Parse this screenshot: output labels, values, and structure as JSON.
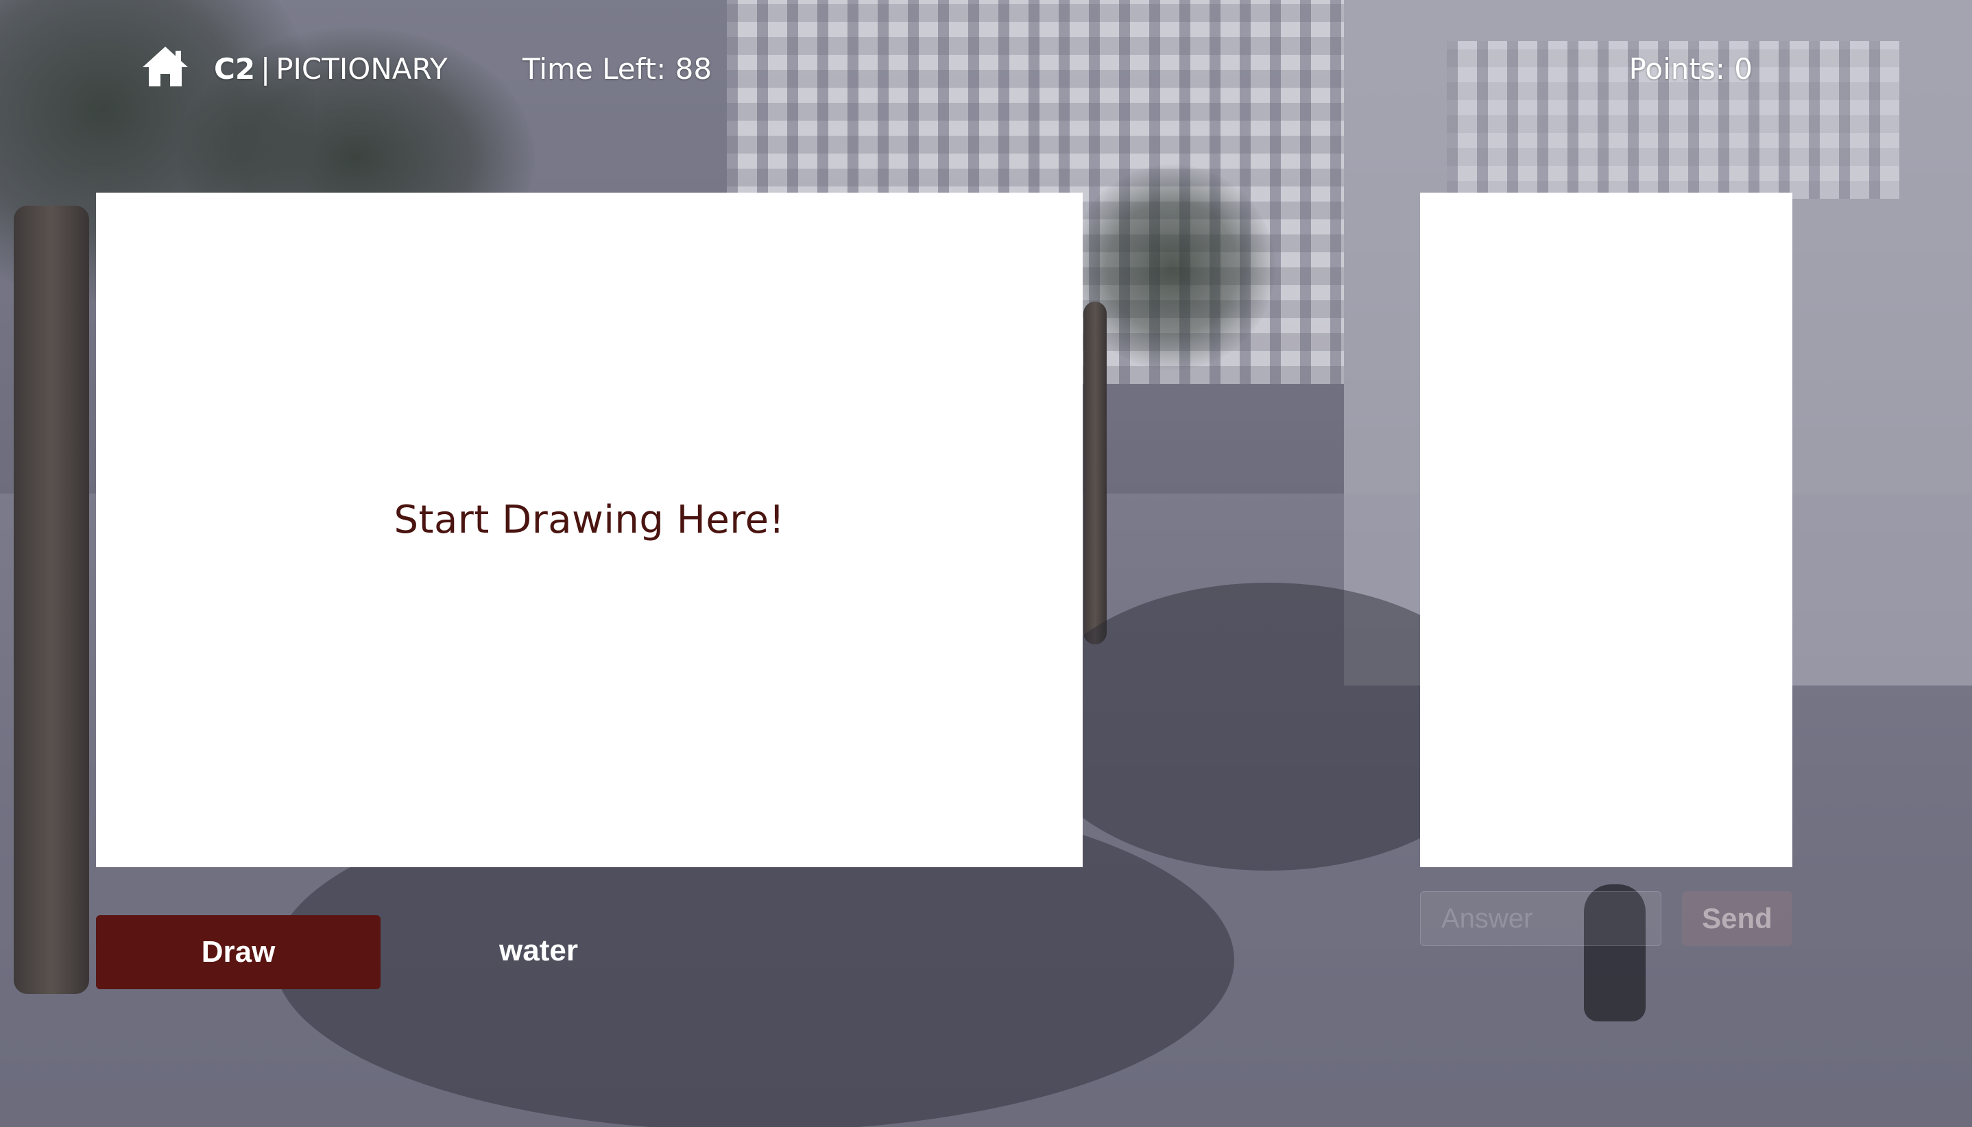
{
  "header": {
    "home_icon": "home-icon",
    "brand_code": "C2",
    "brand_separator": "|",
    "brand_name": "PICTIONARY",
    "time_left_label": "Time Left:",
    "time_left_value": "88",
    "points_label": "Points:",
    "points_value": "0"
  },
  "canvas": {
    "prompt": "Start Drawing Here!"
  },
  "controls": {
    "draw_label": "Draw",
    "word": "water"
  },
  "chat": {
    "answer_placeholder": "Answer",
    "send_label": "Send"
  },
  "colors": {
    "accent": "#5a1512",
    "prompt_text": "#4a1410"
  }
}
